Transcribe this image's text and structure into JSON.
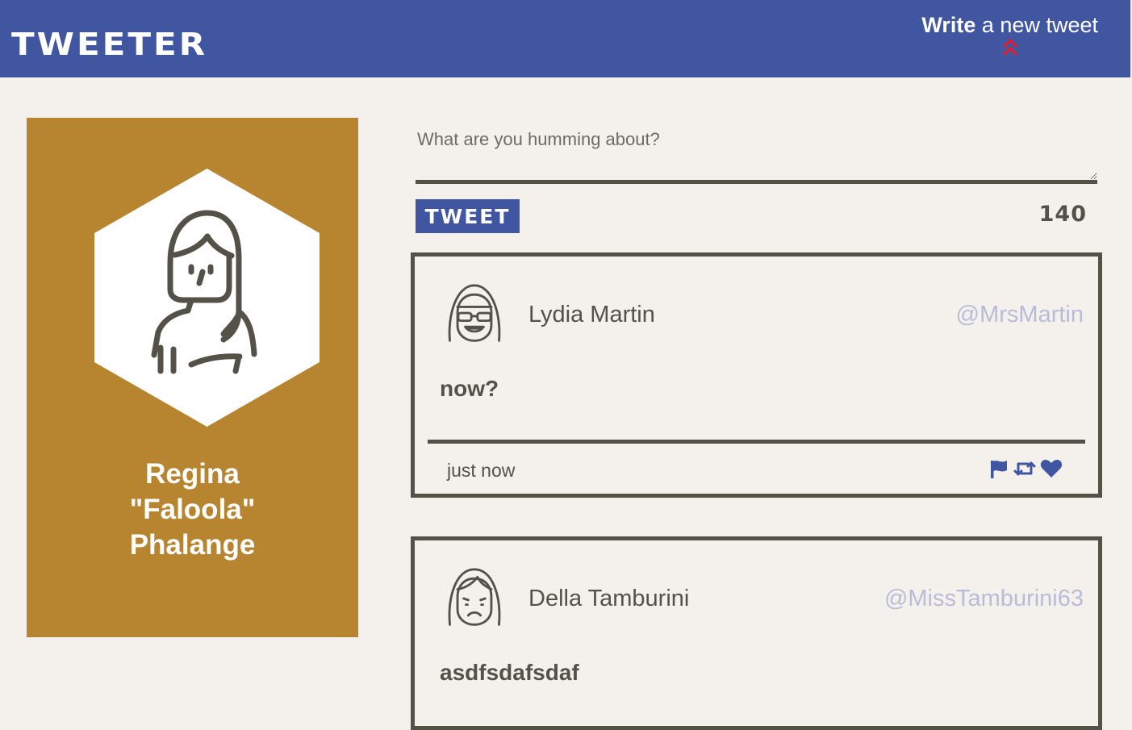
{
  "nav": {
    "brand": "TWEETER",
    "compose_bold": "Write",
    "compose_rest": " a new tweet"
  },
  "profile": {
    "name_first": "Regina",
    "name_nick": "\"Faloola\"",
    "name_last": "Phalange"
  },
  "composer": {
    "placeholder": "What are you humming about?",
    "submit_label": "TWEET",
    "counter": "140"
  },
  "tweets": [
    {
      "name": "Lydia Martin",
      "handle": "@MrsMartin",
      "content": "now?",
      "time": "just now"
    },
    {
      "name": "Della Tamburini",
      "handle": "@MissTamburini63",
      "content": "asdfsdafsdaf"
    }
  ],
  "colors": {
    "navbar": "#4056a1",
    "profile_bg": "#b7842f",
    "page_bg": "#f4f1ec",
    "text": "#545149",
    "handle": "#b9bcd6",
    "accent_arrow": "#e01e2c"
  },
  "icons": {
    "compose_toggle": "double-chevron-up-icon",
    "actions": [
      "flag-icon",
      "retweet-icon",
      "heart-icon"
    ]
  }
}
